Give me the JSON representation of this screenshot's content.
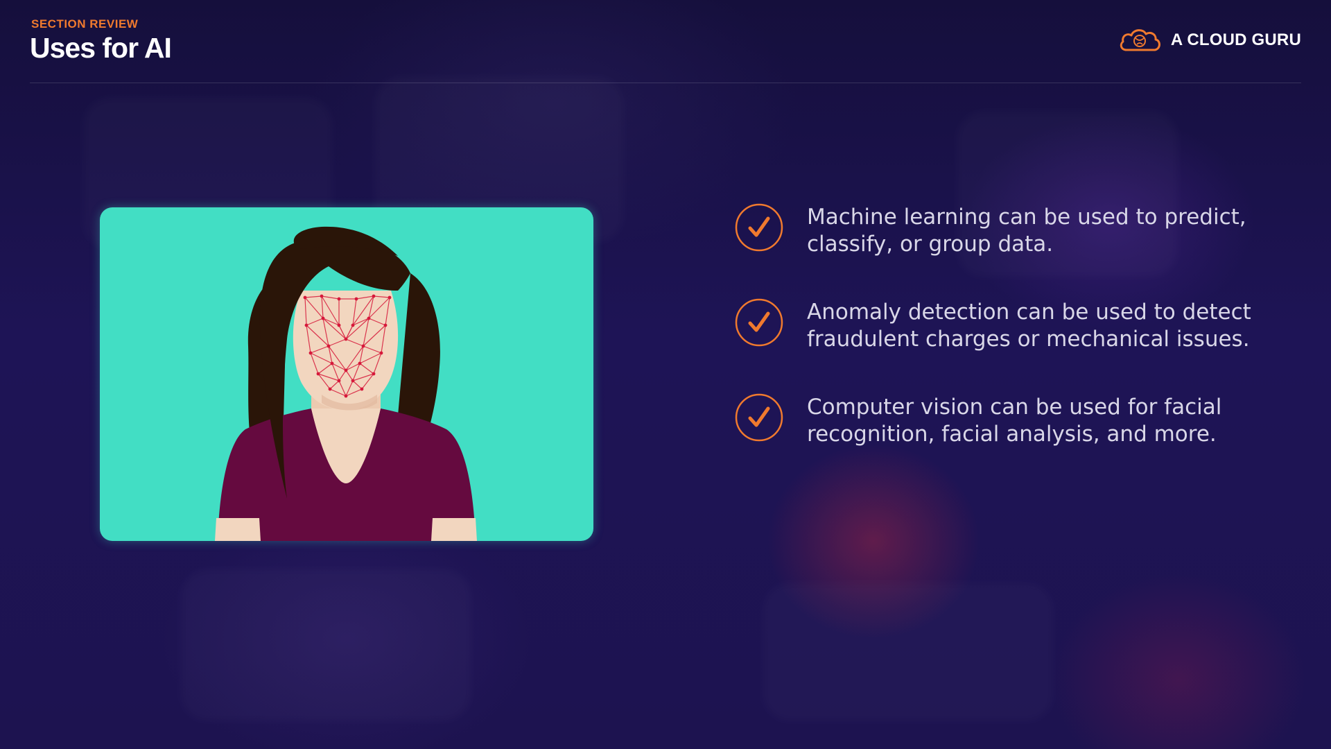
{
  "header": {
    "kicker": "SECTION REVIEW",
    "title": "Uses for AI"
  },
  "brand": {
    "name": "A CLOUD GURU",
    "logo_icon": "cloud-logo-icon",
    "accent_color": "#f07a2e"
  },
  "illustration": {
    "icon": "facial-recognition-illustration",
    "background_color": "#42dec4"
  },
  "bullets": [
    {
      "icon": "check-circle-icon",
      "line1": "Machine learning can be used to predict,",
      "line2": "classify, or group data."
    },
    {
      "icon": "check-circle-icon",
      "line1": "Anomaly detection can be used to detect",
      "line2": "fraudulent charges or mechanical issues."
    },
    {
      "icon": "check-circle-icon",
      "line1": "Computer vision can be used for facial",
      "line2": "recognition, facial analysis, and more."
    }
  ]
}
